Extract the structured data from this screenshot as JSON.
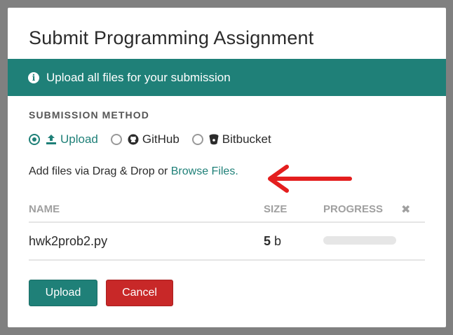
{
  "modal": {
    "title": "Submit Programming Assignment",
    "info_banner": "Upload all files for your submission",
    "section_label": "SUBMISSION METHOD",
    "methods": [
      {
        "label": "Upload",
        "selected": true,
        "icon": "upload-icon"
      },
      {
        "label": "GitHub",
        "selected": false,
        "icon": "github-icon"
      },
      {
        "label": "Bitbucket",
        "selected": false,
        "icon": "bitbucket-icon"
      }
    ],
    "add_files_prefix": "Add files via Drag & Drop or ",
    "browse_link": "Browse Files.",
    "table": {
      "headers": {
        "name": "NAME",
        "size": "SIZE",
        "progress": "PROGRESS",
        "remove_all": "✖"
      },
      "rows": [
        {
          "name": "hwk2prob2.py",
          "size_value": "5",
          "size_unit": "b",
          "progress": 0
        }
      ]
    },
    "buttons": {
      "upload": "Upload",
      "cancel": "Cancel"
    }
  },
  "colors": {
    "accent": "#1f8078",
    "danger": "#c82828",
    "annotation_arrow": "#e41e1e"
  }
}
